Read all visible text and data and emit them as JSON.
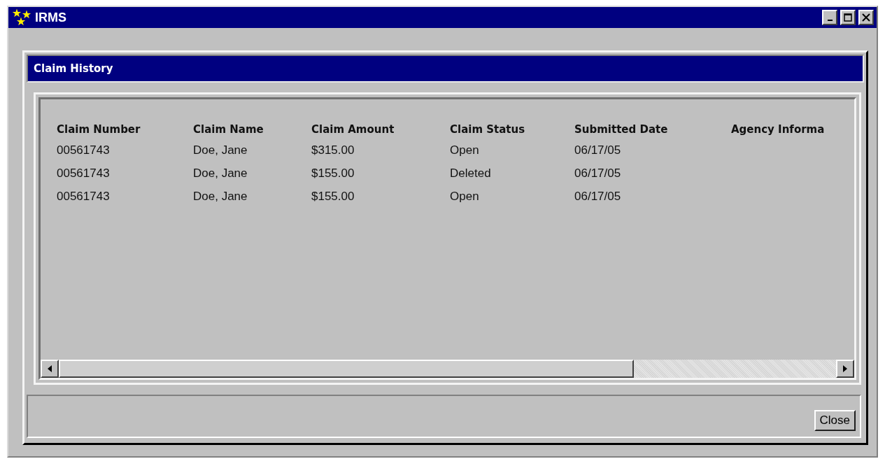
{
  "window": {
    "title": "IRMS"
  },
  "dialog": {
    "title": "Claim History"
  },
  "table": {
    "columns": [
      "Claim Number",
      "Claim Name",
      "Claim Amount",
      "Claim Status",
      "Submitted Date",
      "Agency Informa"
    ],
    "rows": [
      [
        "00561743",
        "Doe, Jane",
        "$315.00",
        "Open",
        "06/17/05"
      ],
      [
        "00561743",
        "Doe, Jane",
        "$155.00",
        "Deleted",
        "06/17/05"
      ],
      [
        "00561743",
        "Doe, Jane",
        "$155.00",
        "Open",
        "06/17/05"
      ]
    ]
  },
  "buttons": [
    "Close"
  ]
}
